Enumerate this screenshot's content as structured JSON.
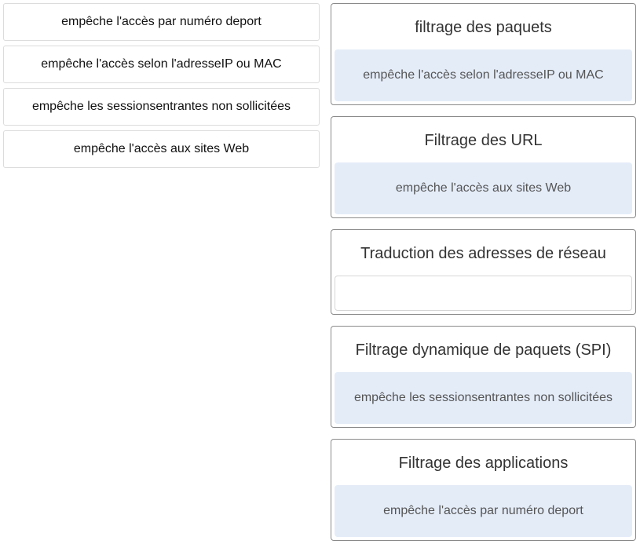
{
  "options": [
    {
      "label": "empêche l'accès par numéro deport"
    },
    {
      "label": "empêche l'accès selon l'adresseIP ou MAC"
    },
    {
      "label": "empêche les sessionsentrantes non sollicitées"
    },
    {
      "label": "empêche l'accès aux sites Web"
    }
  ],
  "targets": [
    {
      "title": "filtrage des paquets",
      "answer": "empêche l'accès selon l'adresseIP ou MAC"
    },
    {
      "title": "Filtrage des URL",
      "answer": "empêche l'accès aux sites Web"
    },
    {
      "title": "Traduction des adresses de réseau",
      "answer": ""
    },
    {
      "title": "Filtrage dynamique de paquets (SPI)",
      "answer": "empêche les sessionsentrantes non sollicitées"
    },
    {
      "title": "Filtrage des applications",
      "answer": "empêche l'accès par numéro deport"
    }
  ]
}
